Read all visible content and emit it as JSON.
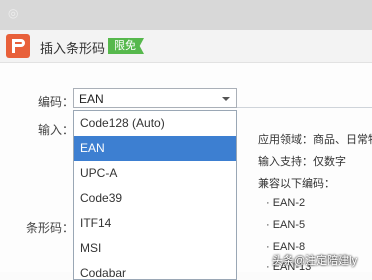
{
  "window_title": "◎",
  "dialog": {
    "title": "插入条形码",
    "badge": "限免"
  },
  "labels": {
    "encoding": "编码：",
    "input": "输入：",
    "barcode": "条形码："
  },
  "select": {
    "value": "EAN"
  },
  "dropdown": {
    "options": [
      "Code128 (Auto)",
      "EAN",
      "UPC-A",
      "Code39",
      "ITF14",
      "MSI",
      "Codabar"
    ],
    "selected": "EAN"
  },
  "info": {
    "scope": "应用领域：商品、日常物",
    "support": "输入支持：仅数字",
    "compat": "兼容以下编码：",
    "codes": [
      "· EAN-2",
      "· EAN-5",
      "· EAN-8",
      "· EAN-13"
    ]
  },
  "watermark": "头条@注定陪建ly",
  "colors": {
    "brand": "#e8603a",
    "badge": "#56b84c",
    "selected": "#3d7fd1"
  }
}
